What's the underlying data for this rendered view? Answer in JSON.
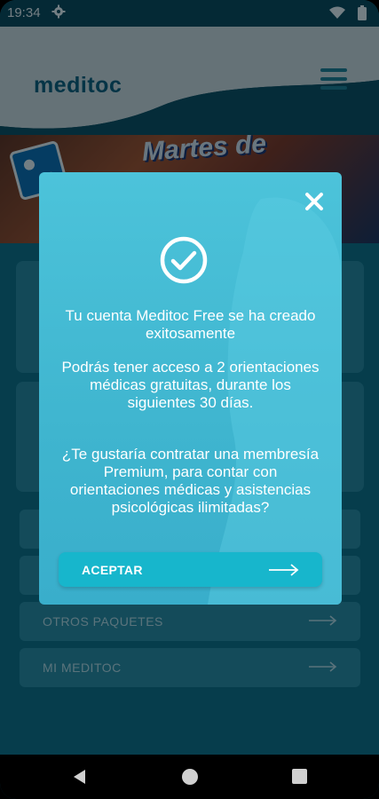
{
  "status_bar": {
    "time": "19:34"
  },
  "header": {
    "brand": "meditoc"
  },
  "banner": {
    "title": "Martes de"
  },
  "menu_rows": [
    {
      "label": ""
    },
    {
      "label": ""
    },
    {
      "label": "OTROS PAQUETES"
    },
    {
      "label": "MI MEDITOC"
    }
  ],
  "modal": {
    "line1": "Tu cuenta Meditoc Free se ha creado exitosamente",
    "line2": "Podrás tener acceso a 2 orientaciones médicas gratuitas, durante los siguientes 30 días.",
    "line3": "¿Te gustaría contratar una membresía Premium, para contar con orientaciones médicas y asistencias psicológicas ilimitadas?",
    "accept_label": "ACEPTAR"
  },
  "colors": {
    "brand": "#0c5b78",
    "modal": "#45bdd5",
    "button": "#17b6cc"
  },
  "icons": [
    "gear-icon",
    "wifi-icon",
    "battery-icon",
    "menu-icon",
    "close-icon",
    "check-circle-icon",
    "arrow-right-icon",
    "back-icon",
    "home-icon",
    "recent-apps-icon"
  ]
}
